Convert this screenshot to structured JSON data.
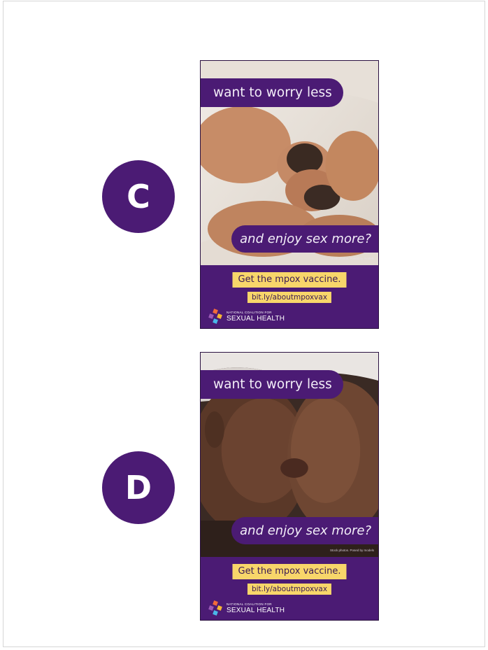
{
  "labels": {
    "c": "C",
    "d": "D"
  },
  "ads": [
    {
      "headline": "want to worry less",
      "subline": "and enjoy sex more?",
      "photo_credit": "Stock photos. Posed by models",
      "cta": "Get the mpox vaccine.",
      "link": "bit.ly/aboutmpoxvax",
      "org_small": "NATIONAL COALITION FOR",
      "org_big": "SEXUAL HEALTH"
    },
    {
      "headline": "want to worry less",
      "subline": "and enjoy sex more?",
      "photo_credit": "Stock photos. Posed by models",
      "cta": "Get the mpox vaccine.",
      "link": "bit.ly/aboutmpoxvax",
      "org_small": "NATIONAL COALITION FOR",
      "org_big": "SEXUAL HEALTH"
    }
  ],
  "colors": {
    "brand_purple": "#4b1b74",
    "highlight_yellow": "#f8d66a"
  }
}
